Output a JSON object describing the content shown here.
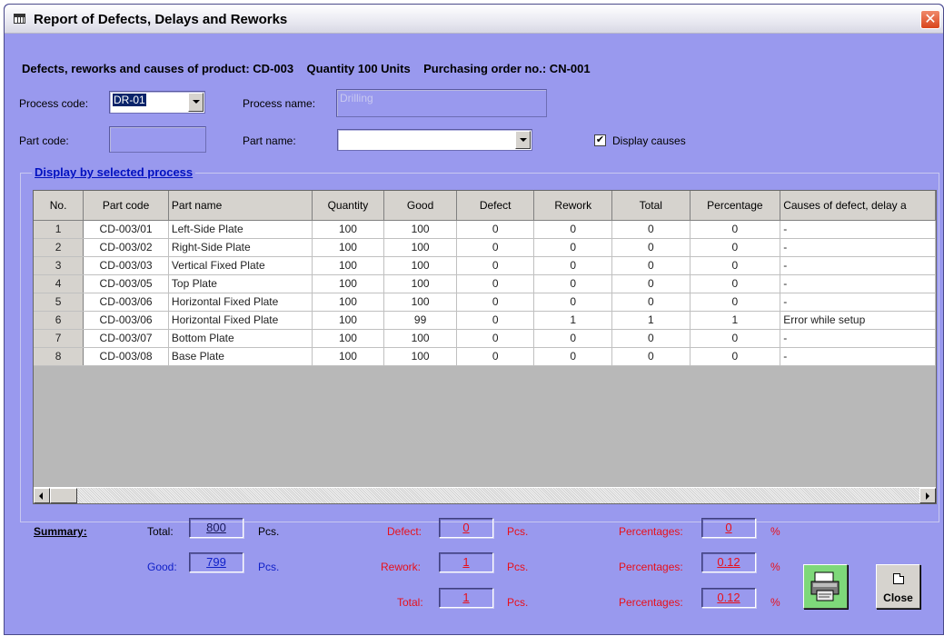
{
  "window": {
    "title": "Report of Defects, Delays and Reworks",
    "close_symbol": "✕"
  },
  "header": {
    "line": "Defects, reworks and causes of product: CD-003    Quantity 100 Units    Purchasing order no.: CN-001"
  },
  "form": {
    "process_code_label": "Process code:",
    "process_code_value": "DR-01",
    "process_name_label": "Process name:",
    "process_name_value": "Drilling",
    "part_code_label": "Part code:",
    "part_code_value": "",
    "part_name_label": "Part name:",
    "part_name_value": "",
    "display_causes_label": "Display causes",
    "display_causes_checked": true,
    "checkmark": "✔"
  },
  "group": {
    "title": "Display by selected process"
  },
  "table": {
    "columns": [
      "No.",
      "Part code",
      "Part name",
      "Quantity",
      "Good",
      "Defect",
      "Rework",
      "Total",
      "Percentage",
      "Causes of defect, delay a"
    ],
    "rows": [
      [
        "1",
        "CD-003/01",
        "Left-Side Plate",
        "100",
        "100",
        "0",
        "0",
        "0",
        "0",
        "-"
      ],
      [
        "2",
        "CD-003/02",
        "Right-Side Plate",
        "100",
        "100",
        "0",
        "0",
        "0",
        "0",
        "-"
      ],
      [
        "3",
        "CD-003/03",
        "Vertical Fixed Plate",
        "100",
        "100",
        "0",
        "0",
        "0",
        "0",
        "-"
      ],
      [
        "4",
        "CD-003/05",
        "Top Plate",
        "100",
        "100",
        "0",
        "0",
        "0",
        "0",
        "-"
      ],
      [
        "5",
        "CD-003/06",
        "Horizontal Fixed Plate",
        "100",
        "100",
        "0",
        "0",
        "0",
        "0",
        "-"
      ],
      [
        "6",
        "CD-003/06",
        "Horizontal Fixed Plate",
        "100",
        "99",
        "0",
        "1",
        "1",
        "1",
        "Error while setup"
      ],
      [
        "7",
        "CD-003/07",
        "Bottom Plate",
        "100",
        "100",
        "0",
        "0",
        "0",
        "0",
        "-"
      ],
      [
        "8",
        "CD-003/08",
        "Base Plate",
        "100",
        "100",
        "0",
        "0",
        "0",
        "0",
        "-"
      ]
    ]
  },
  "summary": {
    "title": "Summary:",
    "total_label": "Total:",
    "total_value": "800",
    "good_label": "Good:",
    "good_value": "799",
    "unit": "Pcs.",
    "defect_label": "Defect:",
    "defect_value": "0",
    "rework_label": "Rework:",
    "rework_value": "1",
    "total2_label": "Total:",
    "total2_value": "1",
    "percentages_label": "Percentages:",
    "pct_defect": "0",
    "pct_rework": "0.12",
    "pct_total": "0.12",
    "pct_unit": "%"
  },
  "buttons": {
    "close_label": "Close",
    "print_icon": "printer-icon"
  },
  "colors": {
    "window_bg": "#9999ee",
    "red": "#e8101a",
    "blue": "#1020c8"
  }
}
